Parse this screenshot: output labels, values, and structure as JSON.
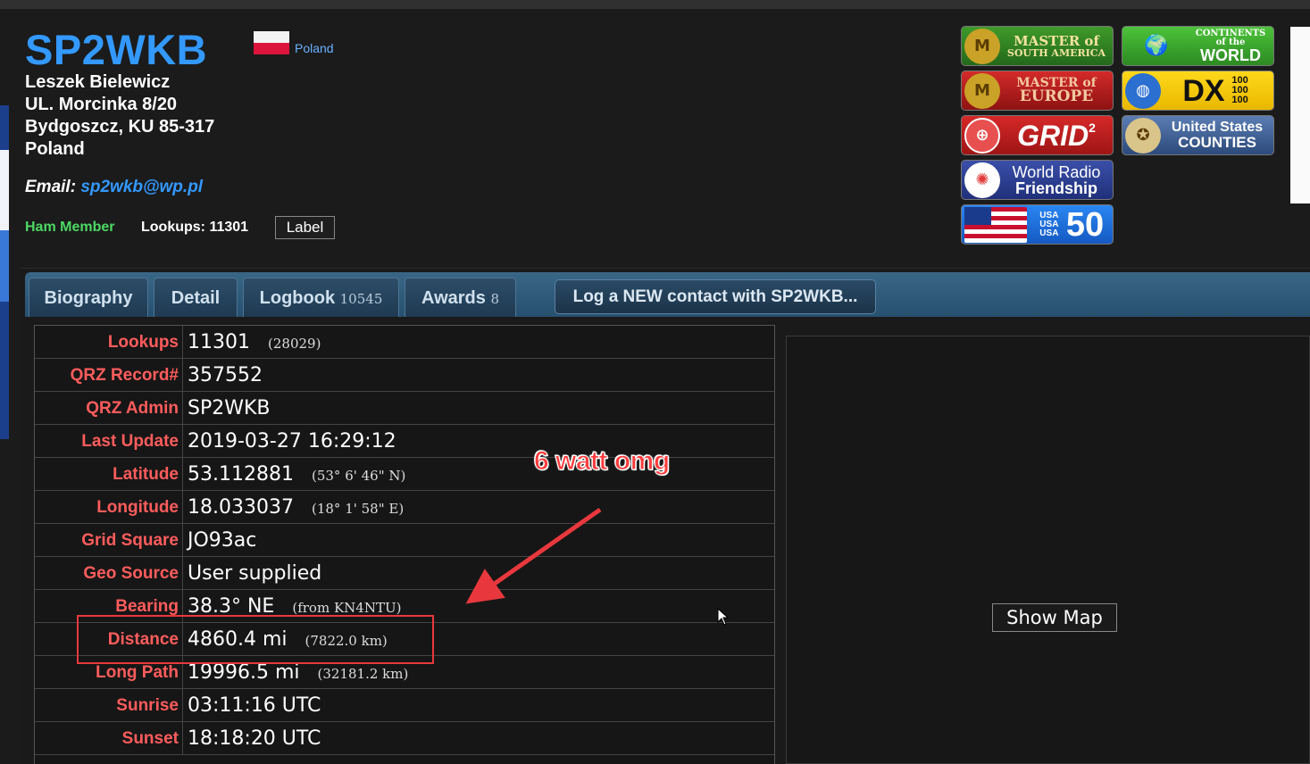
{
  "header": {
    "callsign": "SP2WKB",
    "country_link": "Poland",
    "name": "Leszek Bielewicz",
    "address1": "UL. Morcinka 8/20",
    "address2": "Bydgoszcz, KU 85-317",
    "address_country": "Poland",
    "email_label": "Email:",
    "email": "sp2wkb@wp.pl",
    "member_status": "Ham Member",
    "lookups_summary": "Lookups: 11301",
    "label_button": "Label"
  },
  "awards_badges": [
    {
      "line1": "MASTER of",
      "line2": "SOUTH AMERICA",
      "icon": "medal-icon",
      "bg": "#2e7d1e"
    },
    {
      "line1": "CONTINENTS of the",
      "line2": "WORLD",
      "icon": "world-map-icon",
      "bg": "#35a82a"
    },
    {
      "line1": "MASTER of",
      "line2": "EUROPE",
      "icon": "medal-icon",
      "bg": "#b01c1c"
    },
    {
      "line1": "DX",
      "line2": "100 100 100",
      "icon": "globe-icon",
      "bg": "#f2c500"
    },
    {
      "line1": "GRID",
      "line2": "2",
      "icon": "grid-globe-icon",
      "bg": "#c41e1e"
    },
    {
      "line1": "United States",
      "line2": "COUNTIES",
      "icon": "seal-icon",
      "bg": "#3b5a8a"
    },
    {
      "line1": "World Radio",
      "line2": "Friendship",
      "icon": "radio-globe-icon",
      "bg": "#2e3f8c"
    },
    {
      "line1": "USA USA USA",
      "line2": "50",
      "icon": "us-flag-icon",
      "bg": "#1e6ed8"
    }
  ],
  "tabs": [
    {
      "label": "Biography",
      "count": ""
    },
    {
      "label": "Detail",
      "count": ""
    },
    {
      "label": "Logbook",
      "count": "10545"
    },
    {
      "label": "Awards",
      "count": "8"
    }
  ],
  "log_new_button": "Log a NEW contact with SP2WKB...",
  "detail_rows": [
    {
      "key": "Lookups",
      "value": "11301",
      "sub": "(28029)"
    },
    {
      "key": "QRZ Record#",
      "value": "357552",
      "sub": ""
    },
    {
      "key": "QRZ Admin",
      "value": "SP2WKB",
      "sub": ""
    },
    {
      "key": "Last Update",
      "value": "2019-03-27 16:29:12",
      "sub": ""
    },
    {
      "key": "Latitude",
      "value": "53.112881",
      "sub": "(53° 6' 46\" N)"
    },
    {
      "key": "Longitude",
      "value": "18.033037",
      "sub": "(18° 1' 58\" E)"
    },
    {
      "key": "Grid Square",
      "value": "JO93ac",
      "sub": ""
    },
    {
      "key": "Geo Source",
      "value": "User supplied",
      "sub": ""
    },
    {
      "key": "Bearing",
      "value": "38.3° NE",
      "sub": "(from KN4NTU)"
    },
    {
      "key": "Distance",
      "value": "4860.4 mi",
      "sub": "(7822.0 km)"
    },
    {
      "key": "Long Path",
      "value": "19996.5 mi",
      "sub": "(32181.2 km)"
    },
    {
      "key": "Sunrise",
      "value": "03:11:16 UTC",
      "sub": ""
    },
    {
      "key": "Sunset",
      "value": "18:18:20 UTC",
      "sub": ""
    }
  ],
  "map": {
    "show_button": "Show Map"
  },
  "annotation": {
    "text": "6 watt omg",
    "color": "#e8383d"
  }
}
